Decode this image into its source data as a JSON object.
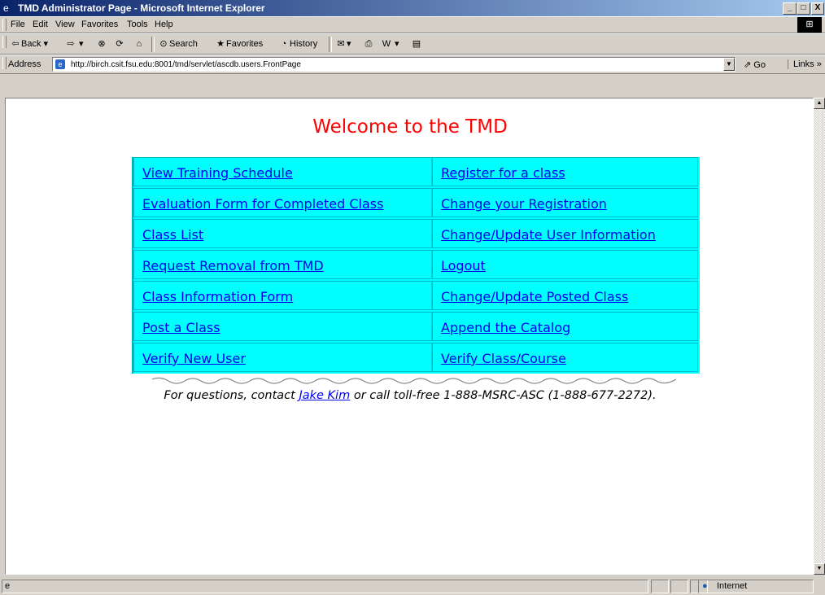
{
  "window": {
    "title": "TMD Administrator Page - Microsoft Internet Explorer",
    "minimize": "_",
    "maximize": "□",
    "close": "X"
  },
  "menubar": [
    "File",
    "Edit",
    "View",
    "Favorites",
    "Tools",
    "Help"
  ],
  "toolbar": {
    "back": "Back",
    "search": "Search",
    "favorites": "Favorites",
    "history": "History"
  },
  "address": {
    "label": "Address",
    "url": "http://birch.csit.fsu.edu:8001/tmd/servlet/ascdb.users.FrontPage",
    "go": "Go",
    "links": "Links"
  },
  "page": {
    "title": "Welcome to the TMD",
    "rows": [
      {
        "left": "View Training Schedule",
        "right": "Register for a class"
      },
      {
        "left": "Evaluation Form for Completed Class",
        "right": "Change your Registration"
      },
      {
        "left": "Class List",
        "right": "Change/Update User Information"
      },
      {
        "left": "Request Removal from TMD",
        "right": "Logout"
      },
      {
        "left": "Class Information Form",
        "right": "Change/Update Posted Class"
      },
      {
        "left": "Post a Class",
        "right": "Append the Catalog"
      },
      {
        "left": "Verify New User",
        "right": "Verify Class/Course"
      }
    ],
    "contact": {
      "before": "For questions, contact ",
      "link": "Jake Kim",
      "after": " or call toll-free 1-888-MSRC-ASC (1-888-677-2272)."
    }
  },
  "status": {
    "zone": "Internet"
  },
  "colors": {
    "table_bg": "#00ffff",
    "title": "#ff0000",
    "link": "#0000ee"
  }
}
